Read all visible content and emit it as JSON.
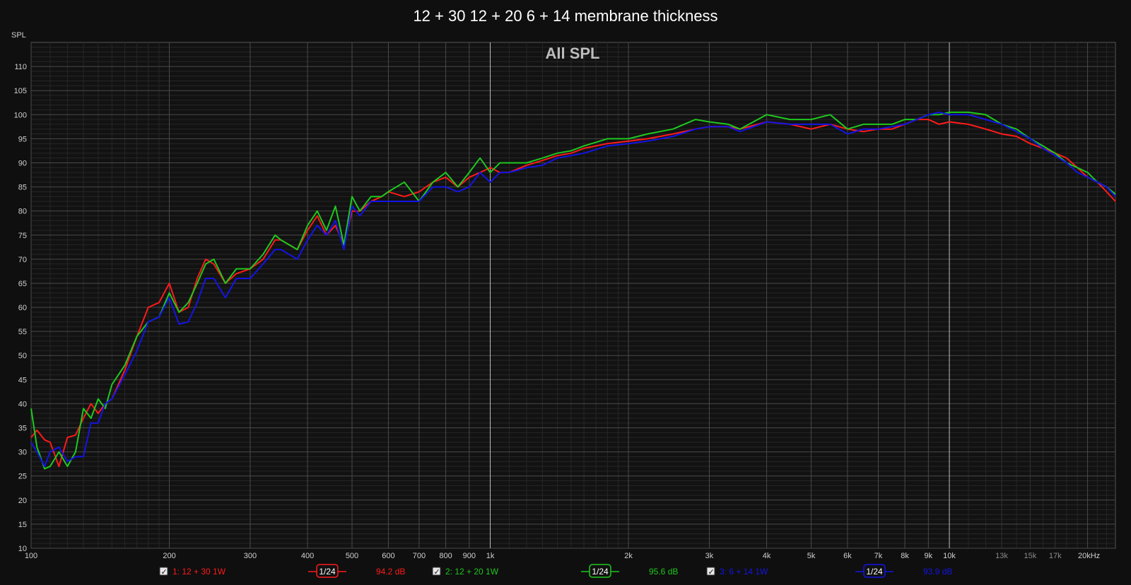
{
  "chart_data": {
    "type": "line",
    "title": "12 + 30 12 + 20 6 + 14 membrane thickness",
    "overlay_title": "All SPL",
    "ylabel": "SPL",
    "xlabel": "",
    "x_scale": "log",
    "xlim": [
      100,
      23000
    ],
    "ylim": [
      10,
      115
    ],
    "y_ticks": [
      10,
      15,
      20,
      25,
      30,
      35,
      40,
      45,
      50,
      55,
      60,
      65,
      70,
      75,
      80,
      85,
      90,
      95,
      100,
      105,
      110
    ],
    "x_ticks": [
      {
        "v": 100,
        "label": "100",
        "dim": false
      },
      {
        "v": 200,
        "label": "200",
        "dim": false
      },
      {
        "v": 300,
        "label": "300",
        "dim": false
      },
      {
        "v": 400,
        "label": "400",
        "dim": false
      },
      {
        "v": 500,
        "label": "500",
        "dim": false
      },
      {
        "v": 600,
        "label": "600",
        "dim": false
      },
      {
        "v": 700,
        "label": "700",
        "dim": false
      },
      {
        "v": 800,
        "label": "800",
        "dim": false
      },
      {
        "v": 900,
        "label": "900",
        "dim": false
      },
      {
        "v": 1000,
        "label": "1k",
        "dim": false
      },
      {
        "v": 2000,
        "label": "2k",
        "dim": false
      },
      {
        "v": 3000,
        "label": "3k",
        "dim": false
      },
      {
        "v": 4000,
        "label": "4k",
        "dim": false
      },
      {
        "v": 5000,
        "label": "5k",
        "dim": false
      },
      {
        "v": 6000,
        "label": "6k",
        "dim": false
      },
      {
        "v": 7000,
        "label": "7k",
        "dim": false
      },
      {
        "v": 8000,
        "label": "8k",
        "dim": false
      },
      {
        "v": 9000,
        "label": "9k",
        "dim": false
      },
      {
        "v": 10000,
        "label": "10k",
        "dim": false
      },
      {
        "v": 13000,
        "label": "13k",
        "dim": true
      },
      {
        "v": 15000,
        "label": "15k",
        "dim": true
      },
      {
        "v": 17000,
        "label": "17k",
        "dim": true
      },
      {
        "v": 20000,
        "label": "20kHz",
        "dim": false
      }
    ],
    "grid": true,
    "legend_placement": "bottom",
    "series": [
      {
        "name": "1: 12 + 30 1W",
        "smoothing": "1/24",
        "level": "94.2 dB",
        "color": "#ff1a1a",
        "x": [
          100,
          103,
          107,
          110,
          115,
          120,
          125,
          130,
          135,
          140,
          145,
          150,
          160,
          170,
          180,
          190,
          200,
          210,
          220,
          230,
          240,
          250,
          265,
          280,
          300,
          320,
          340,
          350,
          380,
          400,
          420,
          440,
          460,
          480,
          500,
          520,
          550,
          580,
          600,
          650,
          700,
          750,
          800,
          850,
          900,
          950,
          1000,
          1050,
          1100,
          1200,
          1300,
          1400,
          1500,
          1600,
          1800,
          2000,
          2200,
          2500,
          2800,
          3000,
          3300,
          3500,
          4000,
          4500,
          5000,
          5500,
          6000,
          6500,
          7000,
          7500,
          8000,
          8500,
          9000,
          9500,
          10000,
          11000,
          12000,
          13000,
          14000,
          15000,
          16000,
          17000,
          18000,
          19000,
          20000,
          21000,
          22000,
          23000
        ],
        "y": [
          33,
          34.5,
          32.5,
          32,
          27,
          33,
          33.5,
          37,
          40,
          38,
          40,
          41,
          47,
          54,
          60,
          61,
          65,
          59,
          60,
          66,
          70,
          69,
          65,
          67,
          68,
          70,
          74,
          74,
          72,
          76,
          79,
          75,
          77,
          73,
          80,
          80,
          82,
          83,
          84,
          83,
          84,
          86,
          87,
          85,
          87,
          88,
          89,
          88,
          88,
          89.5,
          90.5,
          91.5,
          92,
          93,
          94,
          94.5,
          95,
          96,
          97,
          97.5,
          97.5,
          97,
          98.5,
          98,
          97,
          98,
          97,
          96.5,
          97,
          97,
          98,
          99,
          99,
          98,
          98.5,
          98,
          97,
          96,
          95.5,
          94,
          93,
          92,
          91,
          89,
          87,
          86,
          84,
          82
        ]
      },
      {
        "name": "2: 12 + 20 1W",
        "smoothing": "1/24",
        "level": "95.6 dB",
        "color": "#1ec81e",
        "x": [
          100,
          103,
          107,
          110,
          115,
          120,
          125,
          130,
          135,
          140,
          145,
          150,
          160,
          170,
          180,
          190,
          200,
          210,
          220,
          230,
          240,
          250,
          265,
          280,
          300,
          320,
          340,
          350,
          380,
          400,
          420,
          440,
          460,
          480,
          500,
          520,
          550,
          580,
          600,
          650,
          700,
          750,
          800,
          850,
          900,
          950,
          1000,
          1050,
          1100,
          1200,
          1300,
          1400,
          1500,
          1600,
          1800,
          2000,
          2200,
          2500,
          2800,
          3000,
          3300,
          3500,
          4000,
          4500,
          5000,
          5500,
          6000,
          6500,
          7000,
          7500,
          8000,
          8500,
          9000,
          9500,
          10000,
          11000,
          12000,
          13000,
          14000,
          15000,
          16000,
          17000,
          18000,
          19000,
          20000,
          21000,
          22000,
          23000
        ],
        "y": [
          39,
          31,
          26.5,
          27,
          30,
          27,
          30,
          39,
          37,
          41,
          39,
          44,
          48,
          54,
          57,
          58,
          63,
          59,
          61,
          65,
          69,
          70,
          65,
          68,
          68,
          71,
          75,
          74,
          72,
          77,
          80,
          76,
          81,
          73,
          83,
          80,
          83,
          83,
          84,
          86,
          82,
          86,
          88,
          85,
          88,
          91,
          88,
          90,
          90,
          90,
          91,
          92,
          92.5,
          93.5,
          95,
          95,
          96,
          97,
          99,
          98.5,
          98,
          97,
          100,
          99,
          99,
          100,
          97,
          98,
          98,
          98,
          99,
          99,
          100,
          100,
          100.5,
          100.5,
          100,
          98,
          97,
          95,
          93.5,
          92,
          90,
          89,
          88,
          86,
          85,
          83.5
        ]
      },
      {
        "name": "3: 6 + 14 1W",
        "smoothing": "1/24",
        "level": "93.9 dB",
        "color": "#1414e6",
        "x": [
          100,
          103,
          107,
          110,
          115,
          120,
          125,
          130,
          135,
          140,
          145,
          150,
          160,
          170,
          180,
          190,
          200,
          210,
          220,
          230,
          240,
          250,
          265,
          280,
          300,
          320,
          340,
          350,
          380,
          400,
          420,
          440,
          460,
          480,
          500,
          520,
          550,
          580,
          600,
          650,
          700,
          750,
          800,
          850,
          900,
          950,
          1000,
          1050,
          1100,
          1200,
          1300,
          1400,
          1500,
          1600,
          1800,
          2000,
          2200,
          2500,
          2800,
          3000,
          3300,
          3500,
          4000,
          4500,
          5000,
          5500,
          6000,
          6500,
          7000,
          7500,
          8000,
          8500,
          9000,
          9500,
          10000,
          11000,
          12000,
          13000,
          14000,
          15000,
          16000,
          17000,
          18000,
          19000,
          20000,
          21000,
          22000,
          23000
        ],
        "y": [
          32,
          30,
          27,
          30,
          31,
          28,
          29,
          29,
          36,
          36,
          40,
          41,
          46,
          51,
          57,
          58,
          62,
          56.5,
          57,
          61,
          66,
          66,
          62,
          66,
          66,
          69,
          72,
          72,
          70,
          74,
          77,
          75,
          78,
          72,
          81,
          79,
          82,
          82,
          82,
          82,
          82,
          85,
          85,
          84,
          85,
          88,
          86,
          88,
          88,
          89,
          89.5,
          91,
          91.5,
          92,
          93.5,
          94,
          94.5,
          95.5,
          97,
          97.5,
          97.5,
          96.5,
          98.5,
          98,
          98,
          98,
          96,
          97,
          97,
          97.5,
          98,
          99,
          100,
          100.5,
          100,
          100,
          99,
          98,
          96.5,
          95,
          93,
          91.5,
          90,
          88,
          87,
          86,
          85,
          83
        ]
      }
    ]
  }
}
